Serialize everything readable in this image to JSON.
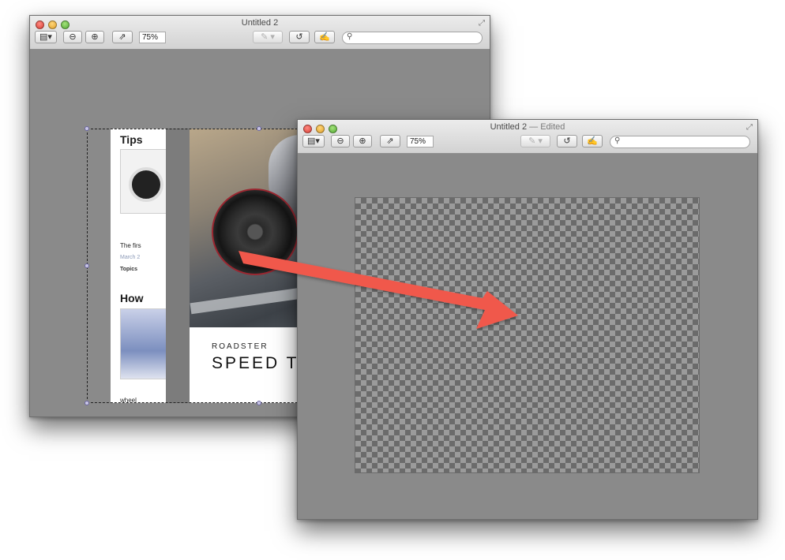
{
  "window1": {
    "title": "Untitled 2",
    "zoom": "75%",
    "search_placeholder": "",
    "page1": {
      "heading1": "Tips",
      "text1": "The firs",
      "meta": "March 2",
      "topics": "Topics",
      "heading2": "How",
      "footer": "wheel"
    },
    "page2": {
      "overline": "ROADSTER",
      "headline": "SPEED TRIP"
    }
  },
  "window2": {
    "title": "Untitled 2",
    "edited": "— Edited",
    "zoom": "75%",
    "search_placeholder": ""
  },
  "arrow": {
    "color": "#f0584c"
  },
  "icons": [
    "sidebar-toggle-icon",
    "zoom-out-icon",
    "zoom-in-icon",
    "share-icon",
    "markup-pen-icon",
    "rotate-icon",
    "edit-toolbar-icon",
    "search-icon",
    "fullscreen-icon"
  ]
}
